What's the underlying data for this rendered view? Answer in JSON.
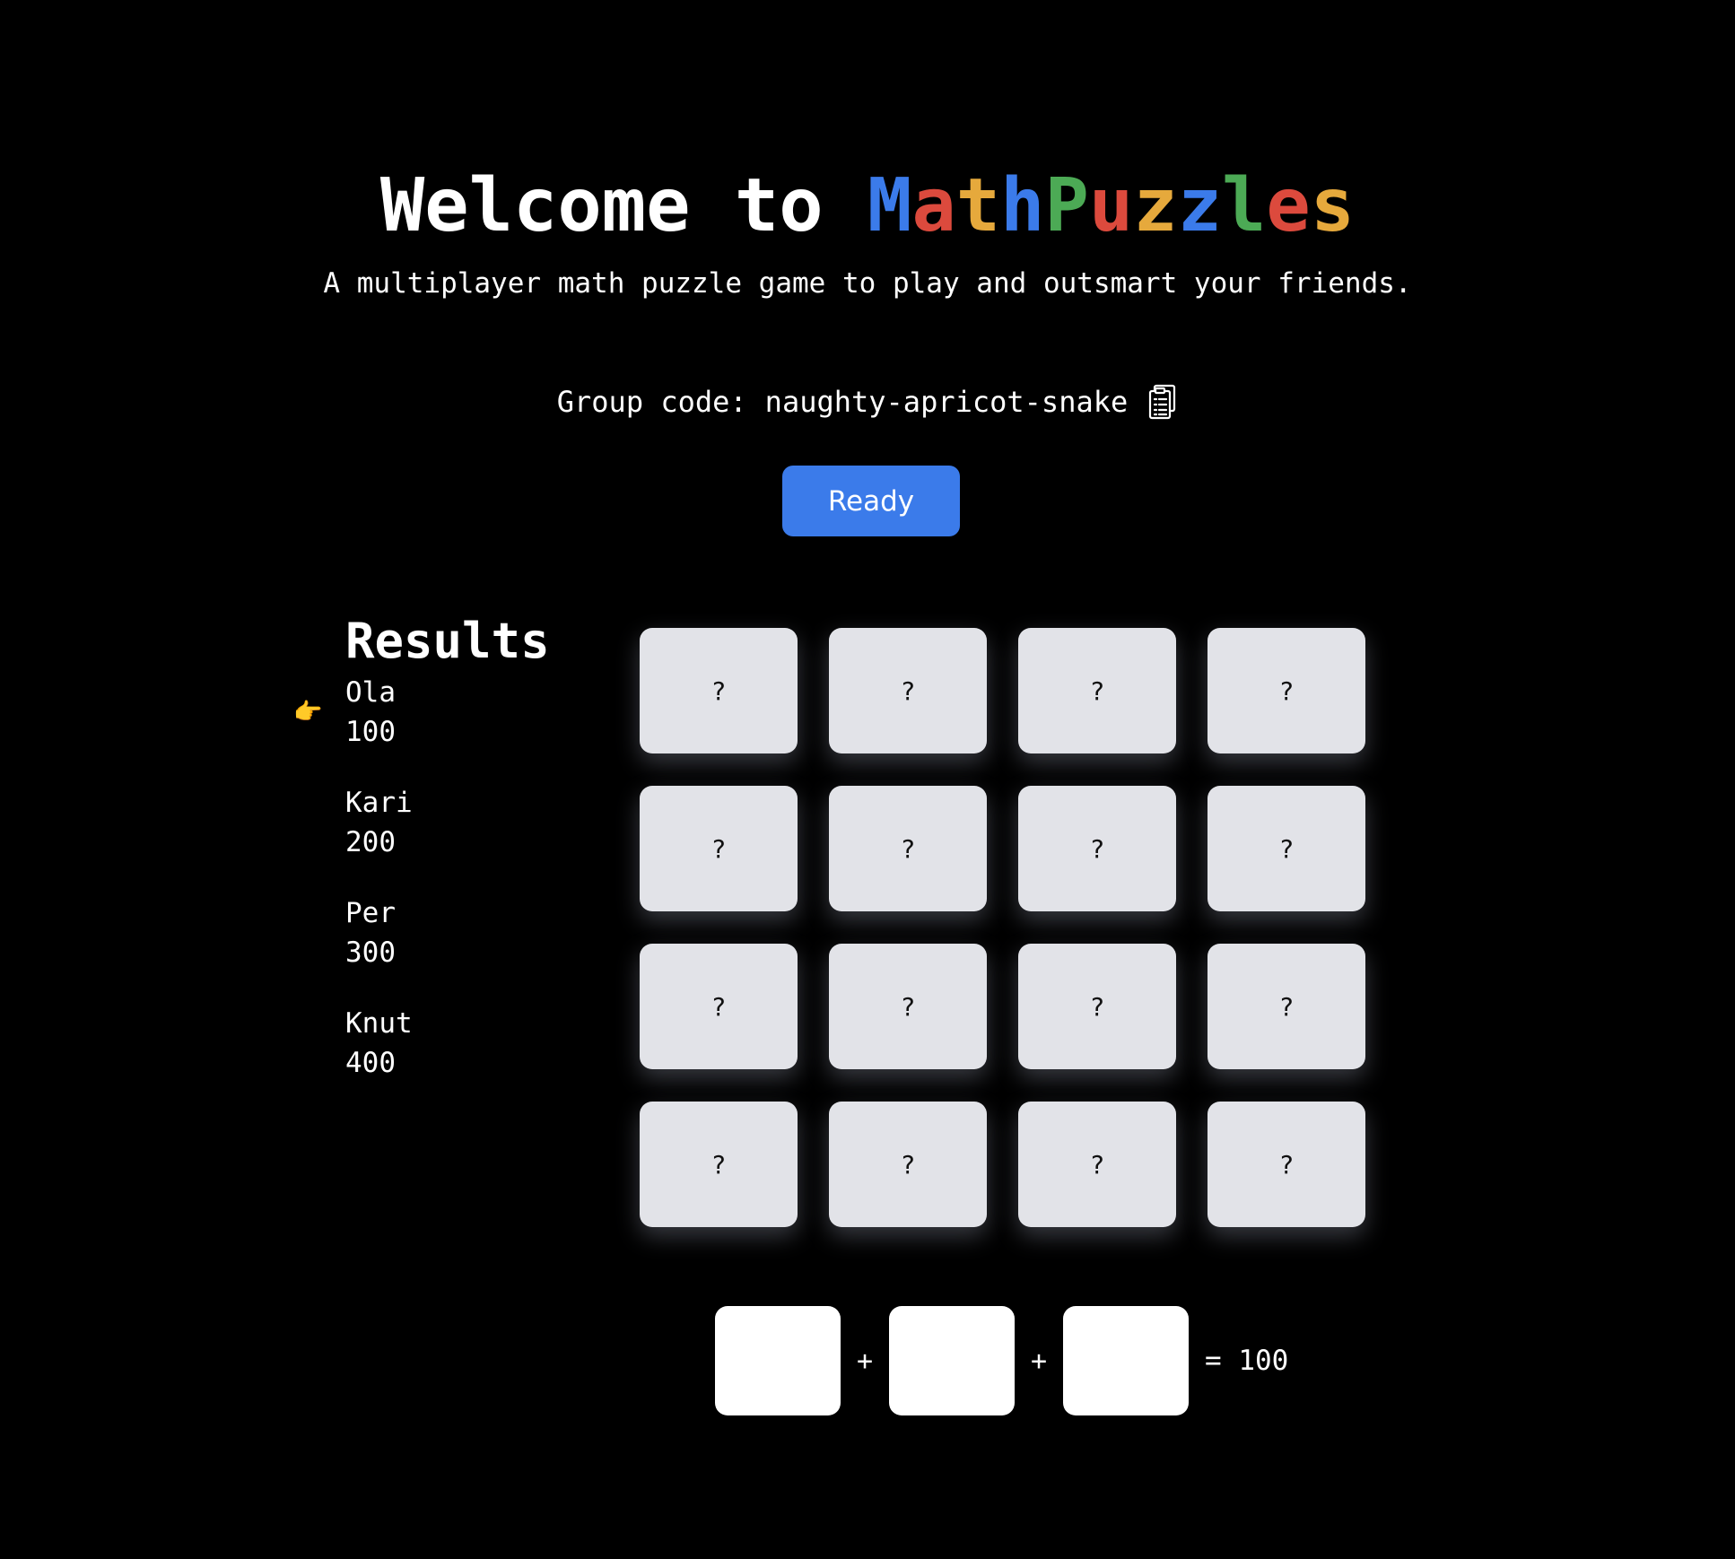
{
  "header": {
    "title_prefix": "Welcome to ",
    "brand_letters": [
      {
        "char": "M",
        "color": "#3b7bea"
      },
      {
        "char": "a",
        "color": "#dc4a3d"
      },
      {
        "char": "t",
        "color": "#e6a93c"
      },
      {
        "char": "h",
        "color": "#3b7bea"
      },
      {
        "char": "P",
        "color": "#4caa55"
      },
      {
        "char": "u",
        "color": "#dc4a3d"
      },
      {
        "char": "z",
        "color": "#e6a93c"
      },
      {
        "char": "z",
        "color": "#3b7bea"
      },
      {
        "char": "l",
        "color": "#4caa55"
      },
      {
        "char": "e",
        "color": "#dc4a3d"
      },
      {
        "char": "s",
        "color": "#e6a93c"
      }
    ],
    "subtitle": "A multiplayer math puzzle game to play and outsmart your friends."
  },
  "group": {
    "label": "Group code:",
    "code": "naughty-apricot-snake",
    "copy_icon": "clipboard-icon"
  },
  "ready_button": {
    "label": "Ready",
    "color": "#3b7bea"
  },
  "results": {
    "title": "Results",
    "current_indicator": "👉",
    "players": [
      {
        "name": "Ola",
        "score": "100",
        "current": true
      },
      {
        "name": "Kari",
        "score": "200",
        "current": false
      },
      {
        "name": "Per",
        "score": "300",
        "current": false
      },
      {
        "name": "Knut",
        "score": "400",
        "current": false
      }
    ]
  },
  "grid": {
    "tiles": [
      "?",
      "?",
      "?",
      "?",
      "?",
      "?",
      "?",
      "?",
      "?",
      "?",
      "?",
      "?",
      "?",
      "?",
      "?",
      "?"
    ]
  },
  "equation": {
    "operator_1": "+",
    "operator_2": "+",
    "equals": "= 100"
  }
}
